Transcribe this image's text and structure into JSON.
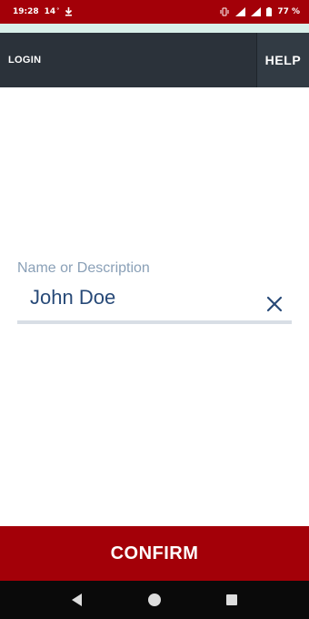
{
  "status_bar": {
    "time": "19:28",
    "temperature": "14",
    "battery_percent": "77 %",
    "icons": [
      "temperature-icon",
      "download-icon",
      "vibrate-icon",
      "signal-icon",
      "wifi-icon",
      "battery-icon"
    ]
  },
  "toolbar": {
    "login_label": "LOGIN",
    "help_label": "HELP"
  },
  "form": {
    "field_label": "Name or Description",
    "field_value": "John Doe",
    "clear_icon": "close-icon"
  },
  "confirm_button": {
    "label": "CONFIRM"
  },
  "nav_bar": {
    "icons": [
      "back-icon",
      "home-icon",
      "recents-icon"
    ]
  },
  "colors": {
    "brand_red": "#a30008",
    "toolbar_dark": "#2b323a",
    "field_text": "#284a78",
    "label_gray_blue": "#8aa0b7"
  }
}
